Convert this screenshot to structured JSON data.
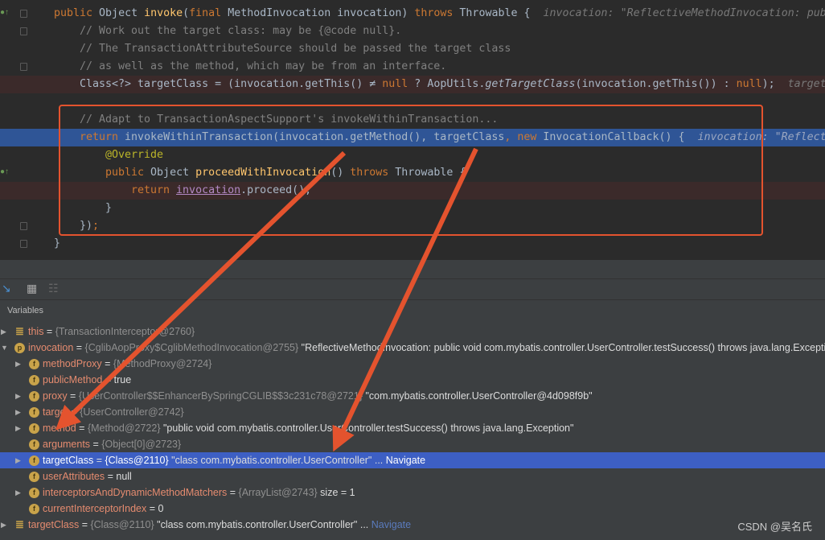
{
  "code_lines": [
    {
      "indent": 1,
      "gutter": "impl",
      "tokens": [
        [
          "public ",
          "kw"
        ],
        [
          "Object ",
          ""
        ],
        [
          "invoke",
          "fn"
        ],
        [
          "(",
          ""
        ],
        [
          "final ",
          "kw"
        ],
        [
          "MethodInvocation invocation) ",
          ""
        ],
        [
          "throws ",
          "kw"
        ],
        [
          "Throwable {  ",
          ""
        ],
        [
          "invocation: \"ReflectiveMethodInvocation: public void com.mybatis.controller.UserController.testSuccess()\"",
          "hint"
        ]
      ]
    },
    {
      "indent": 2,
      "tokens": [
        [
          "// Work out the target class: may be {@code null}.",
          "cm"
        ]
      ]
    },
    {
      "indent": 2,
      "tokens": [
        [
          "// The TransactionAttributeSource should be passed the target class",
          "cm"
        ]
      ]
    },
    {
      "indent": 2,
      "tokens": [
        [
          "// as well as the method, which may be from an interface.",
          "cm"
        ]
      ]
    },
    {
      "indent": 2,
      "gutter": "bp-check",
      "bp": true,
      "tokens": [
        [
          "Class<?> targetClass = (invocation.getThis() ≠ ",
          ""
        ],
        [
          "null",
          "kw"
        ],
        [
          " ? AopUtils.",
          ""
        ],
        [
          "getTargetClass",
          "it"
        ],
        [
          "(invocation.getThis()) : ",
          ""
        ],
        [
          "null",
          "kw"
        ],
        [
          ");  ",
          ""
        ],
        [
          "targetClass: \"class com.mybatis.controller.UserController\"",
          "hint"
        ]
      ]
    },
    {
      "indent": 2,
      "tokens": []
    },
    {
      "indent": 2,
      "tokens": [
        [
          "// Adapt to TransactionAspectSupport's invokeWithinTransaction...",
          "cm"
        ]
      ]
    },
    {
      "indent": 2,
      "current": true,
      "tokens": [
        [
          "return ",
          "kw"
        ],
        [
          "invokeWithinTransaction(invocation.getMethod(), targetClass",
          ""
        ],
        [
          ", ",
          "kw"
        ],
        [
          "new ",
          "kw"
        ],
        [
          "InvocationCallback() {  ",
          ""
        ],
        [
          "invocation: \"ReflectiveMethodInvocation: public void\"",
          "hint"
        ]
      ]
    },
    {
      "indent": 3,
      "tokens": [
        [
          "@Override",
          "an"
        ]
      ]
    },
    {
      "indent": 3,
      "gutter": "impl",
      "tokens": [
        [
          "public ",
          "kw"
        ],
        [
          "Object ",
          ""
        ],
        [
          "proceedWithInvocation",
          "fn"
        ],
        [
          "() ",
          ""
        ],
        [
          "throws ",
          "kw"
        ],
        [
          "Throwable {",
          ""
        ]
      ]
    },
    {
      "indent": 4,
      "gutter": "bp",
      "bp": true,
      "tokens": [
        [
          "return ",
          "kw"
        ],
        [
          "invocation",
          "ul"
        ],
        [
          ".proceed();",
          ""
        ]
      ]
    },
    {
      "indent": 3,
      "tokens": [
        [
          "}",
          ""
        ]
      ]
    },
    {
      "indent": 2,
      "tokens": [
        [
          "})",
          ""
        ],
        [
          ";",
          "kw"
        ]
      ]
    },
    {
      "indent": 1,
      "tokens": [
        [
          "}",
          ""
        ]
      ]
    }
  ],
  "panel": {
    "variables_label": "Variables"
  },
  "variables": [
    {
      "level": 0,
      "expand": "▶",
      "icon": "list-icon",
      "name": "this",
      "ref": "{TransactionInterceptor@2760}",
      "val": ""
    },
    {
      "level": 0,
      "expand": "▼",
      "icon": "p",
      "name": "invocation",
      "ref": "{CglibAopProxy$CglibMethodInvocation@2755}",
      "val": " \"ReflectiveMethodInvocation: public void com.mybatis.controller.UserController.testSuccess() throws java.lang.Exception\""
    },
    {
      "level": 1,
      "expand": "▶",
      "icon": "f",
      "name": "methodProxy",
      "ref": "{MethodProxy@2724}",
      "val": ""
    },
    {
      "level": 1,
      "expand": "",
      "icon": "f",
      "name": "publicMethod",
      "ref": "",
      "val": "true"
    },
    {
      "level": 1,
      "expand": "▶",
      "icon": "f",
      "name": "proxy",
      "ref": "{UserController$$EnhancerBySpringCGLIB$$3c231c78@2721}",
      "val": " \"com.mybatis.controller.UserController@4d098f9b\""
    },
    {
      "level": 1,
      "expand": "▶",
      "icon": "f",
      "name": "target",
      "ref": "{UserController@2742}",
      "val": ""
    },
    {
      "level": 1,
      "expand": "▶",
      "icon": "f",
      "name": "method",
      "ref": "{Method@2722}",
      "val": " \"public void com.mybatis.controller.UserController.testSuccess() throws java.lang.Exception\""
    },
    {
      "level": 1,
      "expand": "",
      "icon": "f",
      "name": "arguments",
      "ref": "{Object[0]@2723}",
      "val": ""
    },
    {
      "level": 1,
      "expand": "▶",
      "icon": "f",
      "name": "targetClass",
      "ref": "{Class@2110}",
      "val": " \"class com.mybatis.controller.UserController\" ...",
      "nav": " Navigate",
      "selected": true
    },
    {
      "level": 1,
      "expand": "",
      "icon": "f",
      "name": "userAttributes",
      "ref": "",
      "val": "null"
    },
    {
      "level": 1,
      "expand": "▶",
      "icon": "f",
      "name": "interceptorsAndDynamicMethodMatchers",
      "ref": "{ArrayList@2743}",
      "val": "  size = 1"
    },
    {
      "level": 1,
      "expand": "",
      "icon": "f",
      "name": "currentInterceptorIndex",
      "ref": "",
      "val": "0"
    },
    {
      "level": 0,
      "expand": "▶",
      "icon": "list-icon",
      "name": "targetClass",
      "ref": "{Class@2110}",
      "val": " \"class com.mybatis.controller.UserController\" ...",
      "nav": " Navigate"
    }
  ],
  "watermark": "CSDN @吴名氏",
  "colors": {
    "annotation_red": "#e4532e",
    "selection": "#3d5fc4",
    "current_line": "#2f5596"
  }
}
